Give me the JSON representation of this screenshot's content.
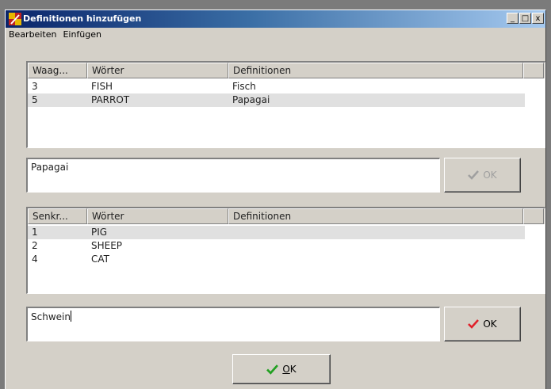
{
  "window": {
    "title": "Definitionen hinzufügen",
    "minimize_glyph": "_",
    "maximize_glyph": "□",
    "close_glyph": "x"
  },
  "menu": [
    "Bearbeiten",
    "Einfügen"
  ],
  "across": {
    "columns": [
      "Waag...",
      "Wörter",
      "Definitionen"
    ],
    "rows": [
      {
        "num": "3",
        "word": "FISH",
        "definition": "Fisch"
      },
      {
        "num": "5",
        "word": "PARROT",
        "definition": "Papagai"
      }
    ],
    "selected_index": 1,
    "definition_value": "Papagai",
    "ok_label": "OK"
  },
  "down": {
    "columns": [
      "Senkr...",
      "Wörter",
      "Definitionen"
    ],
    "rows": [
      {
        "num": "1",
        "word": "PIG",
        "definition": ""
      },
      {
        "num": "2",
        "word": "SHEEP",
        "definition": ""
      },
      {
        "num": "4",
        "word": "CAT",
        "definition": ""
      }
    ],
    "selected_index": 0,
    "definition_value": "Schwein",
    "ok_label": "OK"
  },
  "dialog_ok": {
    "mnemonic": "O",
    "rest": "K"
  },
  "colors": {
    "check_red": "#e0202a",
    "check_green": "#22a022",
    "check_gray": "#a0a0a0"
  },
  "icons": {
    "app": "crossword-app-icon",
    "check": "checkmark-icon"
  }
}
